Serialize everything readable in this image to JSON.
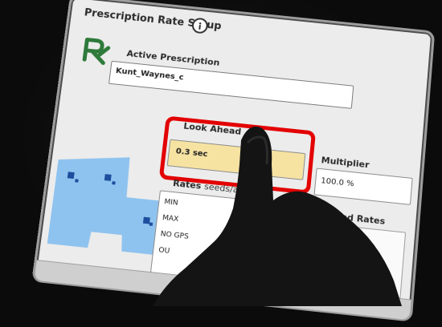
{
  "screen": {
    "title": "Prescription Rate Setup"
  },
  "active_prescription": {
    "label": "Active Prescription",
    "value": "Kunt_Waynes_c"
  },
  "look_ahead": {
    "label": "Look Ahead",
    "value": "0.3 sec"
  },
  "multiplier": {
    "label": "Multiplier",
    "value": "100.0 %"
  },
  "rates": {
    "label": "Rates",
    "unit": "seeds/ac",
    "rows": [
      "MIN",
      "MAX",
      "NO GPS",
      "OU"
    ]
  },
  "multiplied_rates": {
    "label": "ultiplied Rates"
  },
  "icons": {
    "info": "info-icon",
    "rx": "rx-icon"
  },
  "colors": {
    "highlight": "#e30000",
    "look_ahead_field": "#f6e3a2",
    "map_fill": "#8fc3ef",
    "map_dark": "#1d4e9e",
    "rx_green": "#2d7a3a"
  }
}
